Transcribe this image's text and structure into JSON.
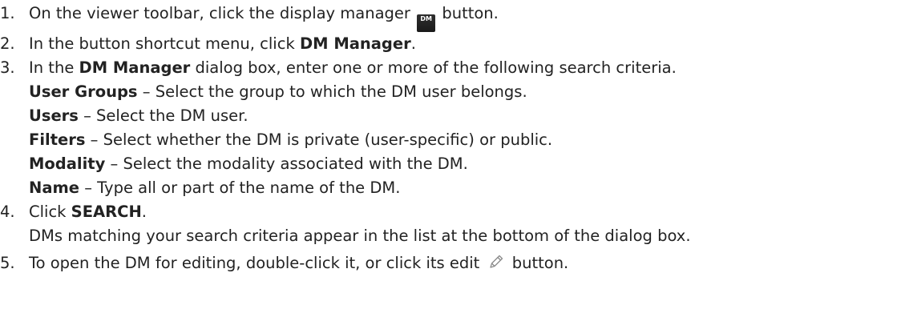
{
  "steps": [
    {
      "num": "1.",
      "before": "On the viewer toolbar, click the display manager ",
      "icon_label": "DM",
      "after": " button."
    },
    {
      "num": "2.",
      "before": "In the button shortcut menu, click ",
      "bold": "DM Manager",
      "after": "."
    },
    {
      "num": "3.",
      "before": "In the ",
      "bold": "DM Manager",
      "after": " dialog box, enter one or more of the following search criteria.",
      "criteria": [
        {
          "term": "User Groups",
          "desc": " – Select the group to which the DM user belongs."
        },
        {
          "term": "Users",
          "desc": " – Select the DM user."
        },
        {
          "term": "Filters",
          "desc": " – Select whether the DM is private (user-specific) or public."
        },
        {
          "term": "Modality",
          "desc": " – Select the modality associated with the DM."
        },
        {
          "term": "Name",
          "desc": " – Type all or part of the name of the DM."
        }
      ]
    },
    {
      "num": "4.",
      "before": "Click ",
      "bold": "SEARCH",
      "after": ".",
      "note": "DMs matching your search criteria appear in the list at the bottom of the dialog box."
    },
    {
      "num": "5.",
      "before": "To open the DM for editing, double-click it, or click its edit ",
      "after": " button."
    }
  ],
  "icons": {
    "display_manager": "dm-icon",
    "edit": "pencil-icon"
  }
}
